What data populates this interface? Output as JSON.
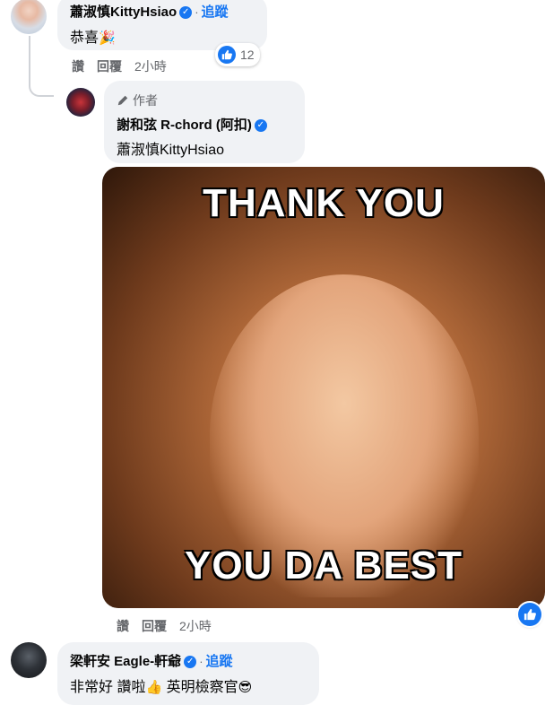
{
  "comments": [
    {
      "author": "蕭淑慎KittyHsiao",
      "separator": "·",
      "follow_label": "追蹤",
      "text": "恭喜",
      "emoji": "🎉",
      "actions": {
        "like": "讚",
        "reply": "回覆",
        "time": "2小時"
      },
      "reaction_count": "12"
    },
    {
      "author_badge": "作者",
      "author": "謝和弦 R-chord (阿扣)",
      "mention": "蕭淑慎KittyHsiao",
      "gif_top_text": "THANK YOU",
      "gif_bottom_text": "YOU DA BEST",
      "actions": {
        "like": "讚",
        "reply": "回覆",
        "time": "2小時"
      }
    },
    {
      "author": "梁軒安 Eagle-軒爺",
      "separator": "·",
      "follow_label": "追蹤",
      "text_part1": "非常好 讚啦",
      "emoji1": "👍",
      "text_part2": "英明檢察官",
      "emoji2": "😎"
    }
  ],
  "colors": {
    "accent": "#1877f2",
    "bubble": "#f0f2f5",
    "muted": "#65676b"
  },
  "icons": [
    "verified-badge-icon",
    "pencil-icon",
    "like-icon"
  ]
}
